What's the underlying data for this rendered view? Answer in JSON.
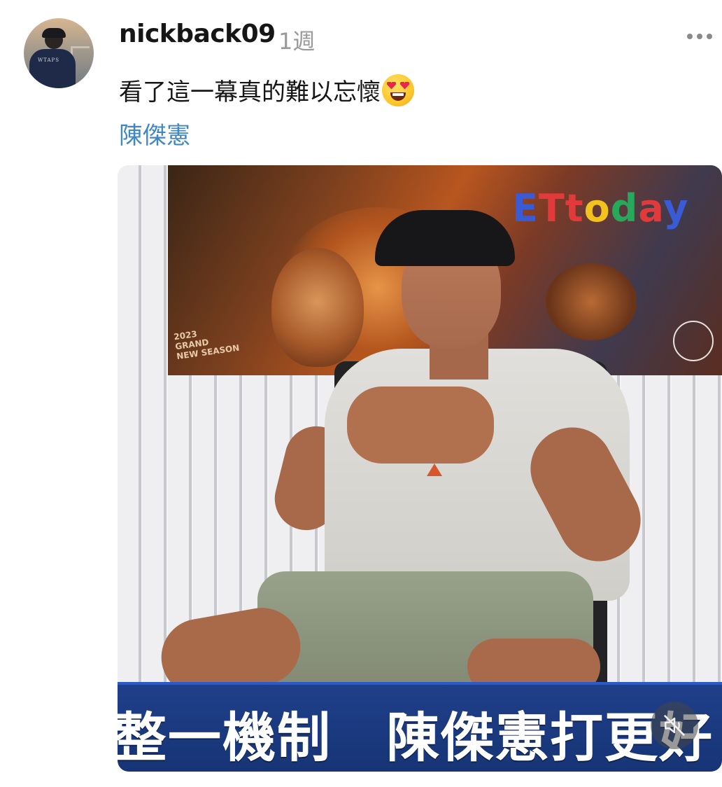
{
  "post": {
    "username": "nickback09",
    "time": "1週",
    "caption": "看了這一幕真的難以忘懷",
    "caption_emoji": "smiling-face-with-heart-eyes",
    "tag": "陳傑憲"
  },
  "media": {
    "poster_brand": "ETtoday",
    "poster_season_text": "2023 GRAND NEW SEASON",
    "subtitle": "整一機制　陳傑憲打更好",
    "mute_icon": "muted-speaker-icon"
  },
  "colors": {
    "tag_link": "#3f88c5",
    "subtitle_bar": "#1f3f8a"
  }
}
